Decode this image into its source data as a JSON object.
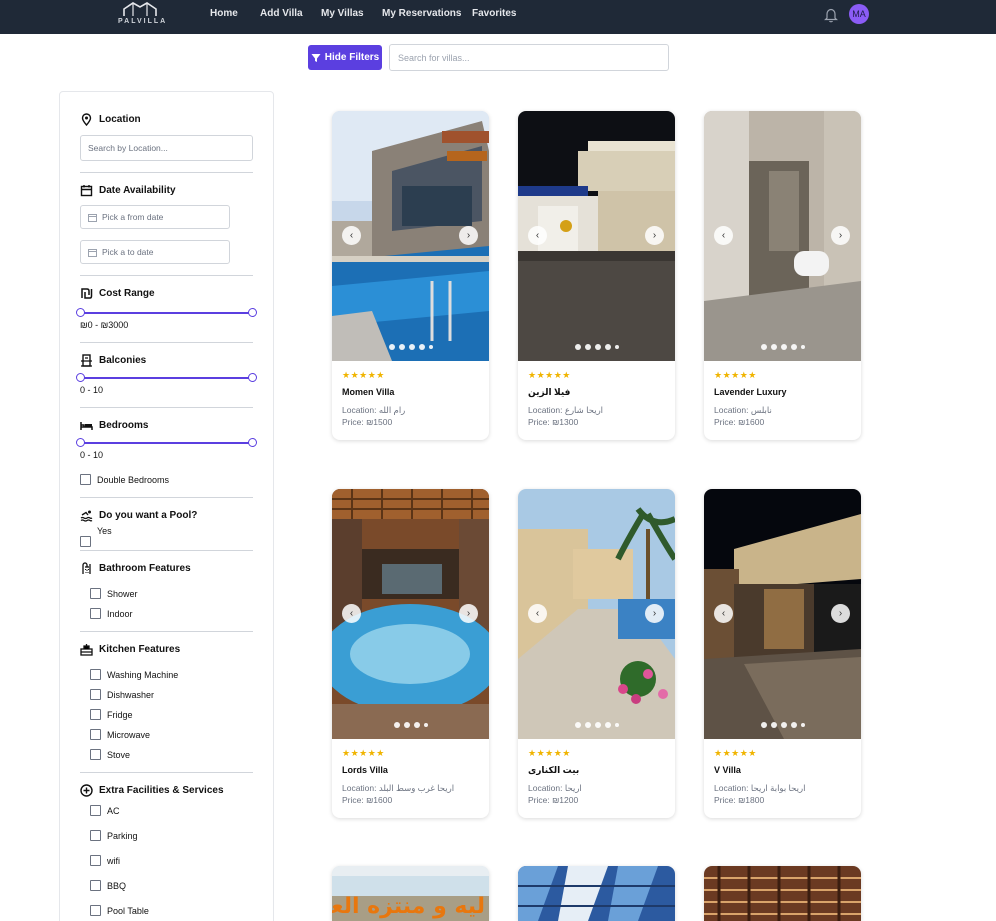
{
  "nav": {
    "brand": "PALVILLA",
    "links": [
      "Home",
      "Add Villa",
      "My Villas",
      "My Reservations",
      "Favorites"
    ],
    "avatar": "MA"
  },
  "filterbar": {
    "hide_filters_label": "Hide Filters",
    "search_placeholder": "Search for villas..."
  },
  "sidebar": {
    "location": {
      "title": "Location",
      "placeholder": "Search by Location..."
    },
    "date": {
      "title": "Date Availability",
      "from_placeholder": "Pick a from date",
      "to_placeholder": "Pick a to date"
    },
    "cost": {
      "title": "Cost Range",
      "range_text": "₪0 - ₪3000",
      "min": 0,
      "max": 3000
    },
    "balconies": {
      "title": "Balconies",
      "range_text": "0 - 10",
      "min": 0,
      "max": 10
    },
    "bedrooms": {
      "title": "Bedrooms",
      "range_text": "0 - 10",
      "min": 0,
      "max": 10,
      "double_label": "Double Bedrooms"
    },
    "pool": {
      "title": "Do you want a Pool?",
      "yes_label": "Yes"
    },
    "bathroom": {
      "title": "Bathroom Features",
      "options": [
        "Shower",
        "Indoor"
      ]
    },
    "kitchen": {
      "title": "Kitchen Features",
      "options": [
        "Washing Machine",
        "Dishwasher",
        "Fridge",
        "Microwave",
        "Stove"
      ]
    },
    "extra": {
      "title": "Extra Facilities & Services",
      "options": [
        "AC",
        "Parking",
        "wifi",
        "BBQ",
        "Pool Table"
      ]
    }
  },
  "cards": [
    {
      "name": "Momen Villa",
      "location_label": "Location:",
      "location": "رام الله",
      "price": "Price: ₪1500",
      "stars": "★★★★★"
    },
    {
      "name": "فيلا الزين",
      "location_label": "Location:",
      "location": "اريحا شارع",
      "price": "Price: ₪1300",
      "stars": "★★★★★"
    },
    {
      "name": "Lavender Luxury",
      "location_label": "Location:",
      "location": "نابلس",
      "price": "Price: ₪1600",
      "stars": "★★★★★"
    },
    {
      "name": "Lords Villa",
      "location_label": "Location:",
      "location": "اريحا غرب وسط البلد",
      "price": "Price: ₪1600",
      "stars": "★★★★★"
    },
    {
      "name": "بيت الكنارى",
      "location_label": "Location:",
      "location": "اريحا",
      "price": "Price: ₪1200",
      "stars": "★★★★★"
    },
    {
      "name": "V Villa",
      "location_label": "Location:",
      "location": "اريحا بوابة اريحا",
      "price": "Price: ₪1800",
      "stars": "★★★★★"
    }
  ],
  "partial_card_text": "ليه و منتزه العز"
}
